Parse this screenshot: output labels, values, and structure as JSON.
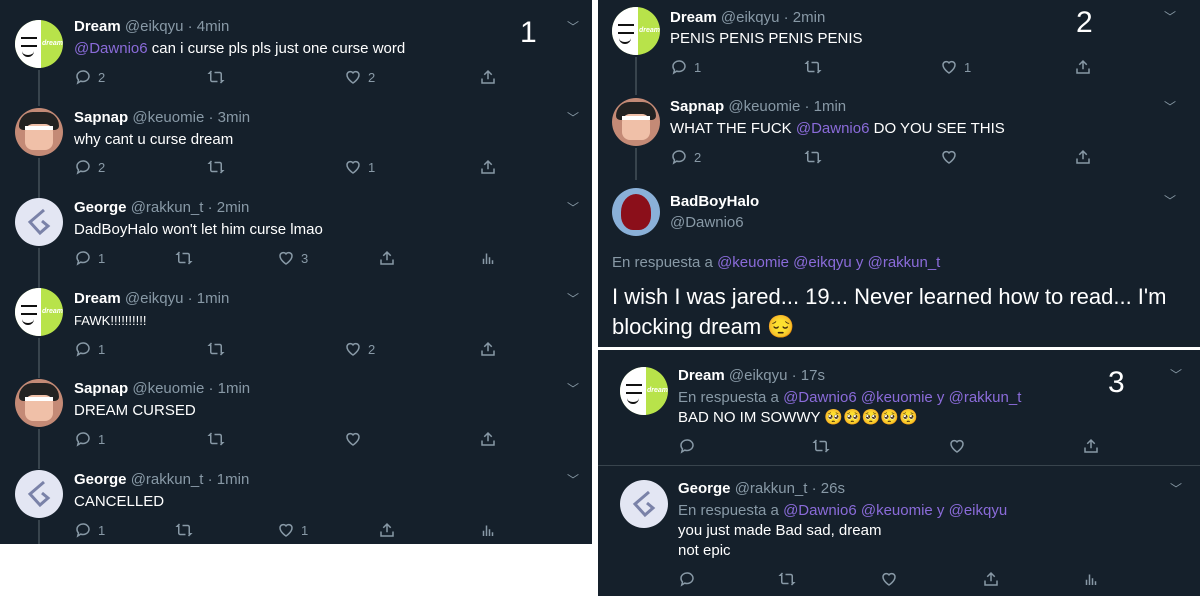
{
  "panel1": {
    "number": "1",
    "tweets": [
      {
        "name": "Dream",
        "handle": "@eikqyu · 4min",
        "mention": "@Dawnio6",
        "text": " can i curse pls pls just one curse word",
        "reply_count": "2",
        "retweet_count": "",
        "like_count": "2"
      },
      {
        "name": "Sapnap",
        "handle": "@keuomie · 3min",
        "mention": "",
        "text": "why cant u curse dream",
        "reply_count": "2",
        "retweet_count": "",
        "like_count": "1"
      },
      {
        "name": "George",
        "handle": "@rakkun_t · 2min",
        "mention": "",
        "text": "DadBoyHalo won't let him curse lmao",
        "reply_count": "1",
        "retweet_count": "",
        "like_count": "3"
      },
      {
        "name": "Dream",
        "handle": "@eikqyu · 1min",
        "mention": "",
        "text": "FAWK!!!!!!!!!!",
        "reply_count": "1",
        "retweet_count": "",
        "like_count": "2"
      },
      {
        "name": "Sapnap",
        "handle": "@keuomie · 1min",
        "mention": "",
        "text": "DREAM CURSED",
        "reply_count": "1",
        "retweet_count": "",
        "like_count": ""
      },
      {
        "name": "George",
        "handle": "@rakkun_t · 1min",
        "mention": "",
        "text": "CANCELLED",
        "reply_count": "1",
        "retweet_count": "",
        "like_count": "1"
      }
    ]
  },
  "panel2": {
    "number": "2",
    "tweet1": {
      "name": "Dream",
      "handle": "@eikqyu · 2min",
      "text": "PENIS PENIS PENIS PENIS",
      "reply_count": "1",
      "like_count": "1"
    },
    "tweet2": {
      "name": "Sapnap",
      "handle": "@keuomie · 1min",
      "text_a": "WHAT THE FUCK ",
      "mention": "@Dawnio6",
      "text_b": " DO YOU SEE THIS",
      "reply_count": "2",
      "like_count": ""
    },
    "tweet3": {
      "name": "BadBoyHalo",
      "handle": "@Dawnio6",
      "reply_prefix": "En respuesta a ",
      "reply_mentions": "@keuomie @eikqyu y @rakkun_t",
      "line1": "I wish I was jared... 19... Never learned how to read... I'm",
      "line2": "blocking dream 😔"
    }
  },
  "panel3": {
    "number": "3",
    "tweet1": {
      "name": "Dream",
      "handle": "@eikqyu · 17s",
      "reply_prefix": "En respuesta a ",
      "reply_mentions": "@Dawnio6 @keuomie y @rakkun_t",
      "text": "BAD NO IM SOWWY 🥺🥺🥺🥺🥺"
    },
    "tweet2": {
      "name": "George",
      "handle": "@rakkun_t · 26s",
      "reply_prefix": "En respuesta a ",
      "reply_mentions": "@Dawnio6 @keuomie y @eikqyu",
      "text_line1": "you just made Bad sad, dream",
      "text_line2": "not epic"
    }
  },
  "icons": [
    "reply-icon",
    "retweet-icon",
    "like-icon",
    "share-icon",
    "analytics-icon",
    "chevron-down-icon"
  ],
  "colors": {
    "background": "#15202b",
    "mention": "#8a6bd9",
    "muted": "#8899a6"
  }
}
